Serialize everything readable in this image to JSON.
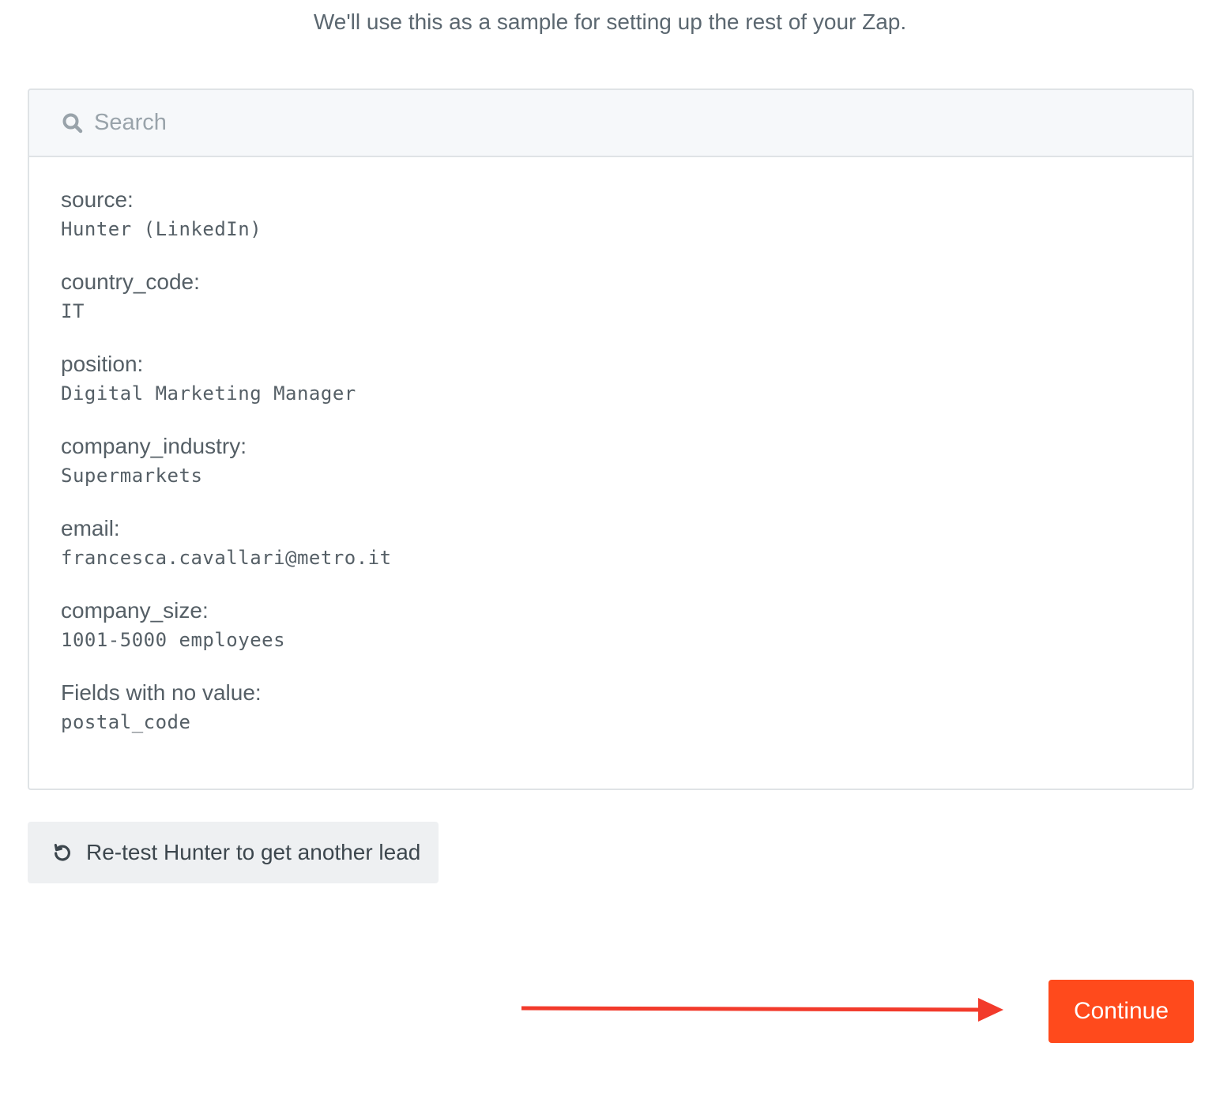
{
  "header": {
    "subtitle": "We'll use this as a sample for setting up the rest of your Zap."
  },
  "search": {
    "placeholder": "Search",
    "value": "",
    "icon": "search-icon"
  },
  "fields": [
    {
      "label": "source:",
      "value": "Hunter (LinkedIn)"
    },
    {
      "label": "country_code:",
      "value": "IT"
    },
    {
      "label": "position:",
      "value": "Digital Marketing Manager"
    },
    {
      "label": "company_industry:",
      "value": "Supermarkets"
    },
    {
      "label": "email:",
      "value": "francesca.cavallari@metro.it"
    },
    {
      "label": "company_size:",
      "value": "1001-5000 employees"
    },
    {
      "label": "Fields with no value:",
      "value": "postal_code"
    }
  ],
  "actions": {
    "retest_label": "Re-test Hunter to get another lead",
    "retest_icon": "refresh-icon",
    "continue_label": "Continue"
  },
  "colors": {
    "accent": "#ff4a1c",
    "annotation_arrow": "#f23a2b",
    "text": "#555f66",
    "panel_border": "#dfe3e6",
    "search_bar_bg": "#f6f8fa",
    "secondary_button_bg": "#eef0f2"
  }
}
